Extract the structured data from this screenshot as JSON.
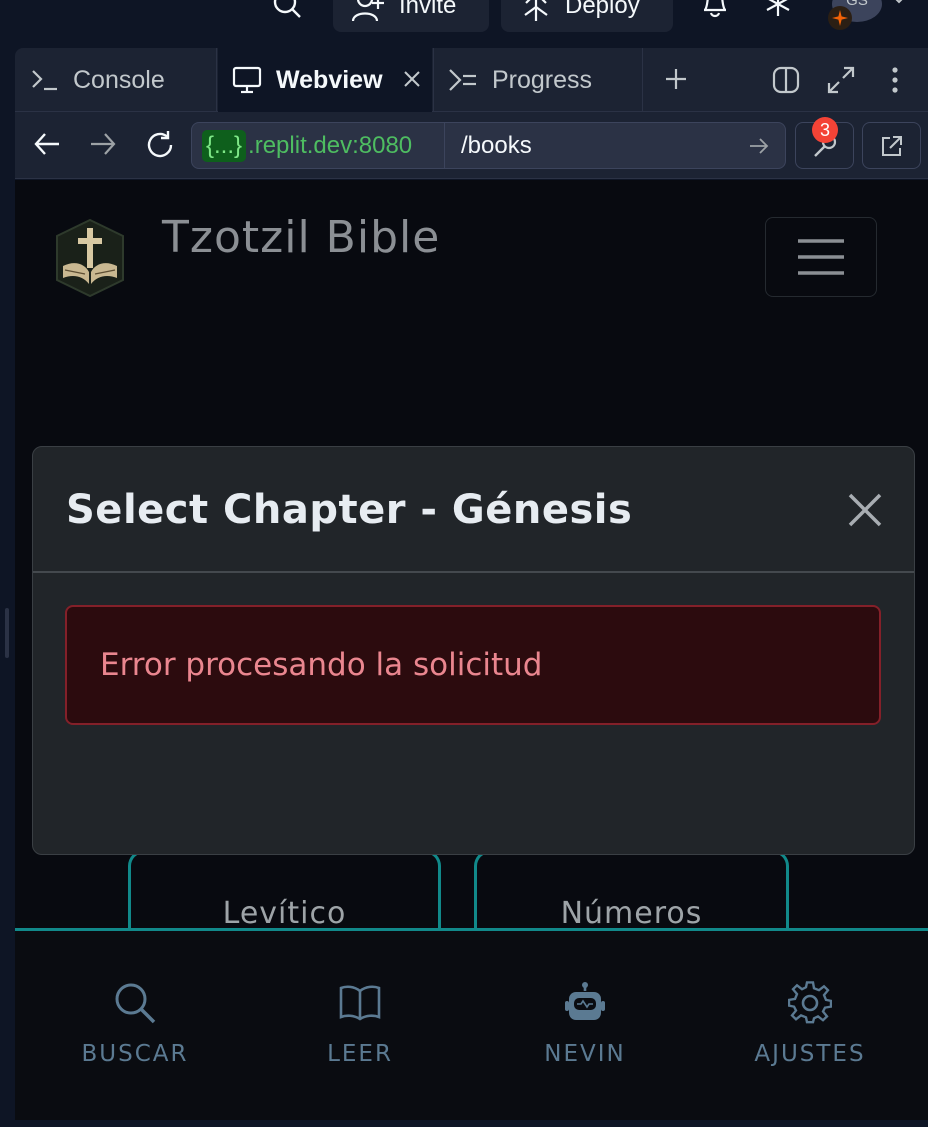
{
  "workspace_header": {
    "invite_label": "Invite",
    "deploy_label": "Deploy",
    "avatar_initials": "GS"
  },
  "panel_tabs": [
    {
      "label": "Console",
      "icon": "terminal-icon",
      "active": false
    },
    {
      "label": "Webview",
      "icon": "monitor-icon",
      "active": true
    },
    {
      "label": "Progress",
      "icon": "progress-icon",
      "active": false
    }
  ],
  "browser": {
    "url_host_pill": "{...}",
    "url_host": ".replit.dev:8080",
    "url_path": "/books",
    "devtools_badge": "3"
  },
  "app": {
    "title": "Tzotzil Bible",
    "books_visible": [
      "Levítico",
      "Números"
    ],
    "bottom_nav": [
      {
        "label": "BUSCAR",
        "icon": "search-icon"
      },
      {
        "label": "LEER",
        "icon": "book-open-icon"
      },
      {
        "label": "NEVIN",
        "icon": "robot-icon"
      },
      {
        "label": "AJUSTES",
        "icon": "gear-icon"
      }
    ]
  },
  "modal": {
    "title": "Select Chapter - Génesis",
    "error_message": "Error procesando la solicitud"
  },
  "colors": {
    "ide_bg": "#0e1525",
    "ide_panel": "#1c2333",
    "app_bg": "#080a10",
    "accent_teal": "#11898a",
    "error_text": "#ea868f",
    "error_bg": "#2c0b0e",
    "url_green": "#4ebd61"
  }
}
